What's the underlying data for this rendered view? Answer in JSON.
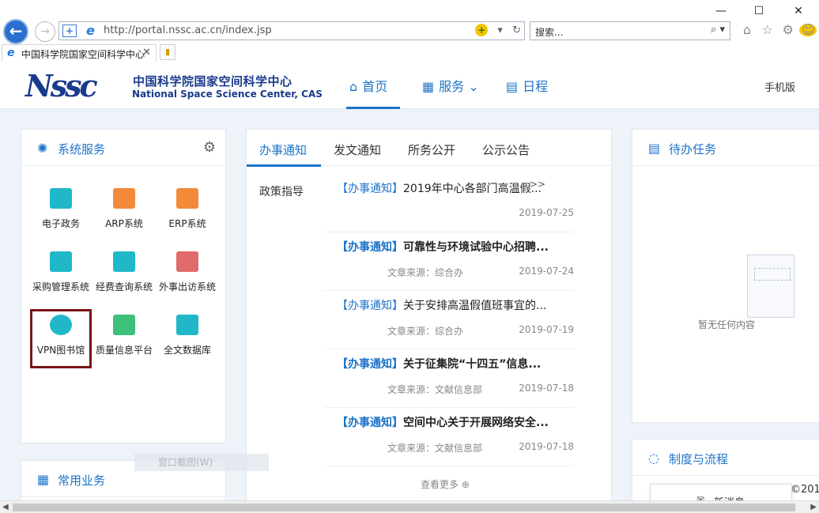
{
  "window": {
    "min": "—",
    "max": "☐",
    "close": "✕"
  },
  "browser": {
    "back": "←",
    "forward": "→",
    "url": "http://portal.nssc.ac.cn/index.jsp",
    "search_placeholder": "搜索...",
    "tab_title": "中国科学院国家空间科学中心"
  },
  "header": {
    "logo_mark": "NSSC",
    "logo_cn": "中国科学院国家空间科学中心",
    "logo_en": "National Space Science Center, CAS",
    "nav": [
      {
        "label": "首页"
      },
      {
        "label": "服务"
      },
      {
        "label": "日程"
      }
    ],
    "mobile": "手机版"
  },
  "system_services": {
    "title": "系统服务",
    "items": [
      {
        "label": "电子政务",
        "color": "#20b8c9"
      },
      {
        "label": "ARP系统",
        "color": "#f28a3a"
      },
      {
        "label": "ERP系统",
        "color": "#f28a3a"
      },
      {
        "label": "采购管理系统",
        "color": "#20b8c9"
      },
      {
        "label": "经费查询系统",
        "color": "#20b8c9"
      },
      {
        "label": "外事出访系统",
        "color": "#e06b6b"
      },
      {
        "label": "VPN图书馆",
        "color": "#20b8c9"
      },
      {
        "label": "质量信息平台",
        "color": "#3cc07a"
      },
      {
        "label": "全文数据库",
        "color": "#20b8c9"
      }
    ]
  },
  "common": {
    "title": "常用业务"
  },
  "news": {
    "tabs": [
      "办事通知",
      "发文通知",
      "所务公开",
      "公示公告"
    ],
    "policy": "政策指导",
    "arrows": ">>",
    "items": [
      {
        "tag": "【办事通知】",
        "title": "2019年中心各部门高温假...",
        "source": "",
        "date": "2019-07-25"
      },
      {
        "tag": "【办事通知】",
        "title": "可靠性与环境试验中心招聘...",
        "source": "文章来源：综合办",
        "date": "2019-07-24"
      },
      {
        "tag": "【办事通知】",
        "title": "关于安排高温假值班事宜的...",
        "source": "文章来源：综合办",
        "date": "2019-07-19"
      },
      {
        "tag": "【办事通知】",
        "title": "关于征集院“十四五”信息...",
        "source": "文章来源：文献信息部",
        "date": "2019-07-18"
      },
      {
        "tag": "【办事通知】",
        "title": "空间中心关于开展网络安全...",
        "source": "文章来源：文献信息部",
        "date": "2019-07-18"
      }
    ],
    "more": "查看更多"
  },
  "todo": {
    "title": "待办任务",
    "empty": "暂无任何内容"
  },
  "rules": {
    "title": "制度与流程"
  },
  "faded_menu": "窗口截图(W)",
  "message": {
    "label": "新消息"
  },
  "fragment": "©201"
}
